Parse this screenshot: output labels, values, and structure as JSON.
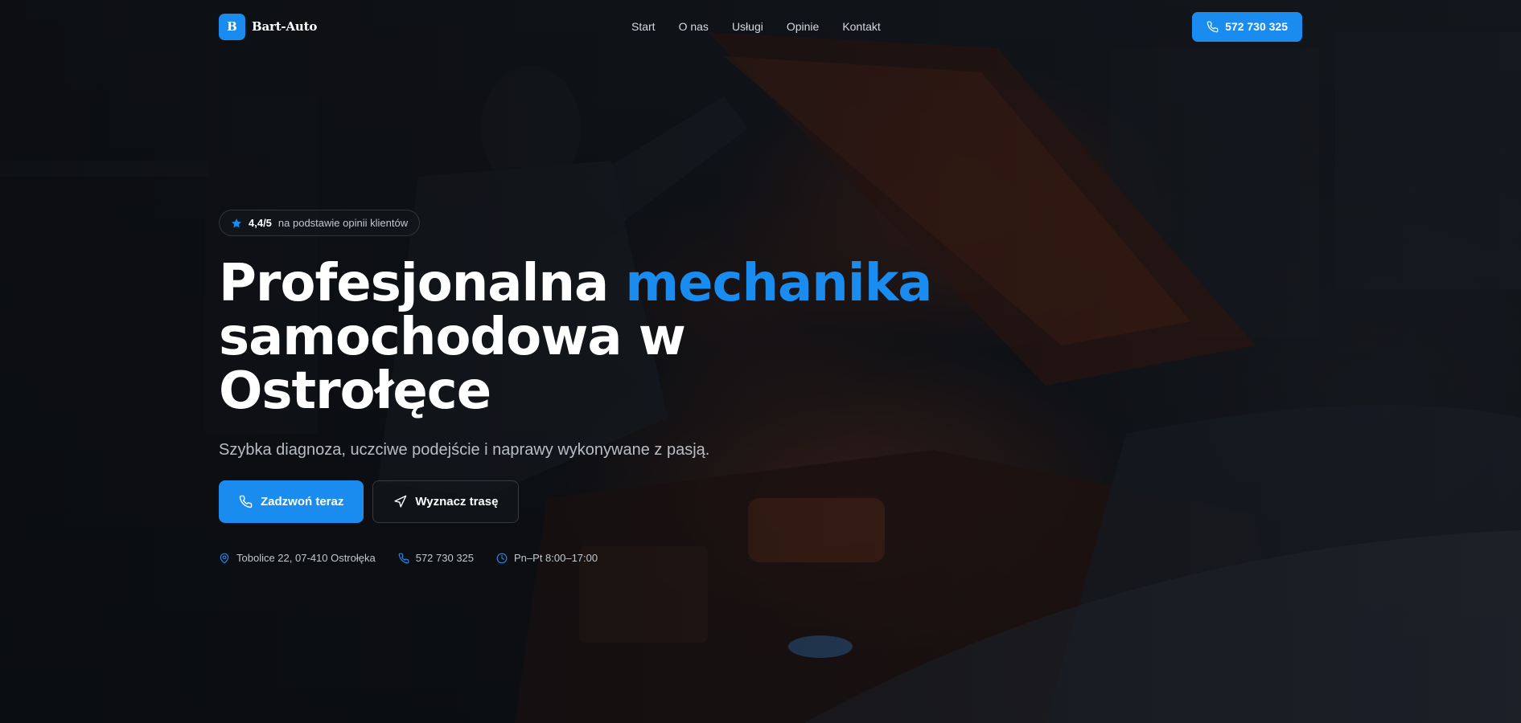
{
  "brand": {
    "logo_letter": "B",
    "name": "Bart-Auto"
  },
  "nav": {
    "links": [
      "Start",
      "O nas",
      "Usługi",
      "Opinie",
      "Kontakt"
    ],
    "cta_phone": "572 730 325"
  },
  "hero": {
    "rating_score": "4,4/5",
    "rating_text": "na podstawie opinii klientów",
    "headline_part1": "Profesjonalna ",
    "headline_accent": "mechanika",
    "headline_part2": "samochodowa w",
    "headline_part3": "Ostrołęce",
    "subhead": "Szybka diagnoza, uczciwe podejście i naprawy wykonywane z pasją.",
    "primary_button": "Zadzwoń teraz",
    "secondary_button": "Wyznacz trasę"
  },
  "info": {
    "address": "Tobolice 22, 07-410 Ostrołęka",
    "phone": "572 730 325",
    "hours": "Pn–Pt 8:00–17:00"
  },
  "colors": {
    "accent": "#1a8cf0",
    "background": "#0c0f14",
    "muted_text": "#c3c8cf"
  },
  "icons": {
    "rating": "star-icon",
    "phone": "phone-icon",
    "route": "navigation-arrow-icon",
    "address": "map-pin-icon",
    "hours": "clock-icon"
  }
}
